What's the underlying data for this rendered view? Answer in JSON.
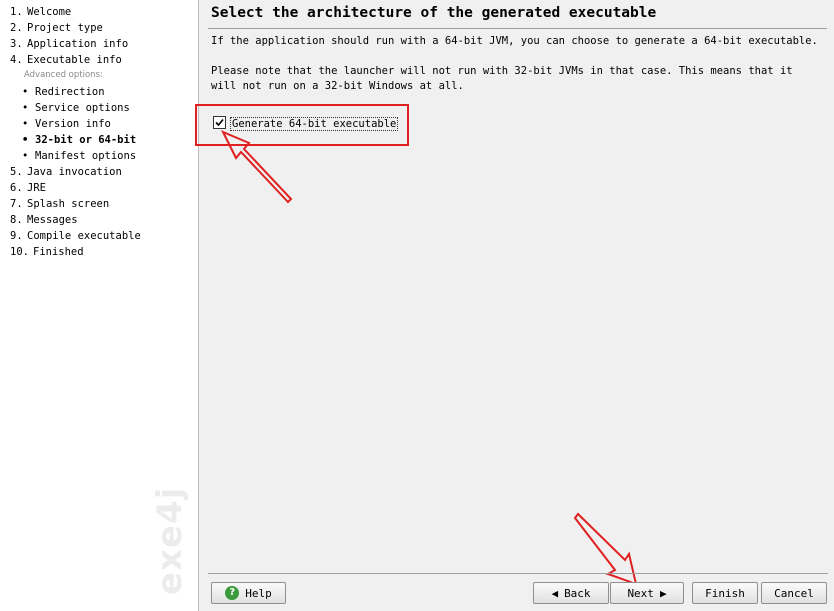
{
  "sidebar": {
    "steps_top": [
      {
        "num": "1.",
        "label": "Welcome"
      },
      {
        "num": "2.",
        "label": "Project type"
      },
      {
        "num": "3.",
        "label": "Application info"
      },
      {
        "num": "4.",
        "label": "Executable info"
      }
    ],
    "advanced_label": "Advanced options:",
    "sub_items": [
      {
        "label": "Redirection"
      },
      {
        "label": "Service options"
      },
      {
        "label": "Version info"
      },
      {
        "label": "32-bit or 64-bit",
        "active": true
      },
      {
        "label": "Manifest options"
      }
    ],
    "steps_bottom": [
      {
        "num": "5.",
        "label": "Java invocation"
      },
      {
        "num": "6.",
        "label": "JRE"
      },
      {
        "num": "7.",
        "label": "Splash screen"
      },
      {
        "num": "8.",
        "label": "Messages"
      },
      {
        "num": "9.",
        "label": "Compile executable"
      },
      {
        "num": "10.",
        "label": "Finished"
      }
    ],
    "logo": "exe4j"
  },
  "main": {
    "title": "Select the architecture of the generated executable",
    "paragraph1": "If the application should run with a 64-bit JVM, you can choose to generate a 64-bit executable.",
    "paragraph2": "Please note that the launcher will not run with 32-bit JVMs in that case. This means that it will not run on a 32-bit Windows at all.",
    "checkbox": {
      "label": "Generate 64-bit executable",
      "checked": true
    }
  },
  "buttons": {
    "help": "Help",
    "back": "Back",
    "next": "Next",
    "finish": "Finish",
    "cancel": "Cancel"
  },
  "colors": {
    "annotation": "#e02020",
    "help_icon": "#3a9a3a"
  }
}
